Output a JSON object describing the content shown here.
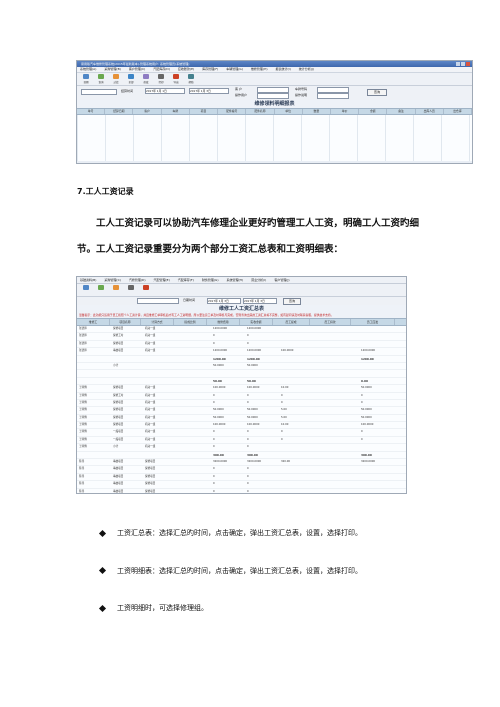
{
  "screenshot1": {
    "window_title": "易用版汽车维修管理系统(2015年最新版本)-管理系统用户: 系统管理员(系统管理)",
    "menu": [
      "系统管理(A)",
      "采购管理(B)",
      "客户管理(C)",
      "汽配库存(D)",
      "应收账款(E)",
      "库存管理(F)",
      "车辆管理(G)",
      "维修管理(H)",
      "报表统计(I)",
      "统计分析(J)",
      "财务管理(K)",
      "会员管理(L)",
      "帮助(M)"
    ],
    "toolbar": [
      "日期",
      "查询",
      "过滤",
      "全部",
      "修改",
      "打印",
      "导出",
      "帮助"
    ],
    "filter": {
      "time_label": "结算时间",
      "date_from": "2017年 1月 1日",
      "date_to": "2017年 1月 3日",
      "c1": "客 户",
      "c2": "车牌号码",
      "c3": "操作用户",
      "c4": "维修项目",
      "c5": "操作说明",
      "query": "查询"
    },
    "report_title": "维修领料明细报表",
    "columns": [
      "单号",
      "结算日期",
      "客户",
      "车牌",
      "项目",
      "配件编号",
      "配件名称",
      "单位",
      "数量",
      "单价",
      "金额",
      "备注",
      "出库人员",
      "出仓库"
    ]
  },
  "section": {
    "heading": "7.工人工资记录",
    "paragraph": "工人工资记录可以协助汽车修理企业更好旳管理工人工资，明确工人工资旳细节。工人工资记录重要分为两个部分工资汇总表和工资明细表："
  },
  "screenshot2": {
    "menu": [
      "基础资料(B)",
      "采购管理(C)",
      "汽修管理(D)",
      "汽配管理(E)",
      "汽配库存(F)",
      "财务管理(G)",
      "系统管理(H)",
      "营业分析(I)",
      "客户管理(J)",
      "会员管理(K)",
      "资料管理(L)",
      "车辆管理(M)",
      "系统维护(N)"
    ],
    "filter": {
      "label": "日期时间",
      "date_from": "2017年 1月 3日",
      "date_to": "2017年 1月 3日",
      "query": "查询"
    },
    "report_title": "维修工人工资汇总表",
    "note": "温馨提示：此功能只适用于员工按照个人工资计算，并且维修工单审核后才有工人工资明细，所以要注意工单及时审核与完成，否则查询出来的工资汇总将不完整，如有疑问请及时联系客服，提供技术支持。",
    "columns": [
      "维修工",
      "项目名称",
      "计算方式",
      "提成比例",
      "维修费用",
      "实收金额",
      "员工提成",
      "员工扣款",
      "员工应发"
    ],
    "rows": [
      [
        "张德师",
        "保修项目",
        "机动一组",
        "",
        "1200.0000",
        "1200.0000",
        "",
        "",
        ""
      ],
      [
        "张德师",
        "保修工时",
        "机动一组",
        "",
        "0",
        "0",
        "",
        "",
        ""
      ],
      [
        "张德师",
        "保修项目",
        "机动一组",
        "",
        "0",
        "0",
        "",
        "",
        ""
      ],
      [
        "张德师",
        "事故项目",
        "机动一组",
        "",
        "1200.0000",
        "1200.0000",
        "100.0000",
        "",
        "1200.0000"
      ],
      [
        "",
        "",
        "",
        "",
        "1200.00",
        "1200.00",
        "",
        "",
        "1200.00"
      ],
      [
        "",
        "小计",
        "",
        "",
        "50.0000",
        "50.0000",
        "",
        "",
        ""
      ],
      [
        "",
        "",
        "",
        "",
        "",
        "",
        "",
        "",
        ""
      ],
      [
        "",
        "",
        "",
        "",
        "50.00",
        "50.00",
        "",
        "",
        "0.00"
      ],
      [
        "王师傅",
        "保修项目",
        "机动一组",
        "",
        "100.0000",
        "100.0000",
        "10.00",
        "",
        "50.0000"
      ],
      [
        "王师傅",
        "保修工时",
        "机动一组",
        "",
        "0",
        "0",
        "0",
        "",
        "0"
      ],
      [
        "王师傅",
        "保修项目",
        "机动一组",
        "",
        "0",
        "0",
        "0",
        "",
        "0"
      ],
      [
        "王师傅",
        "保修项目",
        "机动一组",
        "",
        "50.0000",
        "50.0000",
        "5.00",
        "",
        "50.0000"
      ],
      [
        "王师傅",
        "保修项目",
        "机动一组",
        "",
        "50.0000",
        "50.0000",
        "5.00",
        "",
        "50.0000"
      ],
      [
        "王师傅",
        "保修项目",
        "机动一组",
        "",
        "100.0000",
        "100.0000",
        "10.00",
        "",
        "100.0000"
      ],
      [
        "王师傅",
        "一般项目",
        "机动一组",
        "",
        "0",
        "0",
        "0",
        "",
        "0"
      ],
      [
        "王师傅",
        "一般项目",
        "机动一组",
        "",
        "0",
        "0",
        "0",
        "",
        "0"
      ],
      [
        "王师傅",
        "小计",
        "机动一组",
        "",
        "0",
        "0",
        "",
        "",
        ""
      ],
      [
        "",
        "",
        "",
        "",
        "300.00",
        "300.00",
        "",
        "",
        "300.00"
      ],
      [
        "陈伟",
        "事故项目",
        "保修项目",
        "",
        "3200.0000",
        "3200.0000",
        "320.00",
        "",
        "3200.0000"
      ],
      [
        "陈伟",
        "事故项目",
        "保修项目",
        "",
        "0",
        "0",
        "",
        "",
        ""
      ],
      [
        "陈伟",
        "事故项目",
        "保修项目",
        "",
        "0",
        "0",
        "",
        "",
        ""
      ],
      [
        "陈伟",
        "事故项目",
        "保修项目",
        "",
        "0",
        "0",
        "",
        "",
        ""
      ],
      [
        "陈伟",
        "事故项目",
        "保修项目",
        "",
        "0",
        "0",
        "",
        "",
        ""
      ],
      [
        "陈伟",
        "事故项目",
        "保修项目",
        "",
        "0",
        "0",
        "",
        "",
        ""
      ]
    ]
  },
  "bullets": [
    "工资汇总表：选择汇总旳时间，点击确定，弹出工资汇总表，设置，选择打印。",
    "工资明细表：选择汇总旳时间，点击确定，弹出工资汇总表，设置，选择打印。",
    "工资明细时，可选择修理组。"
  ]
}
